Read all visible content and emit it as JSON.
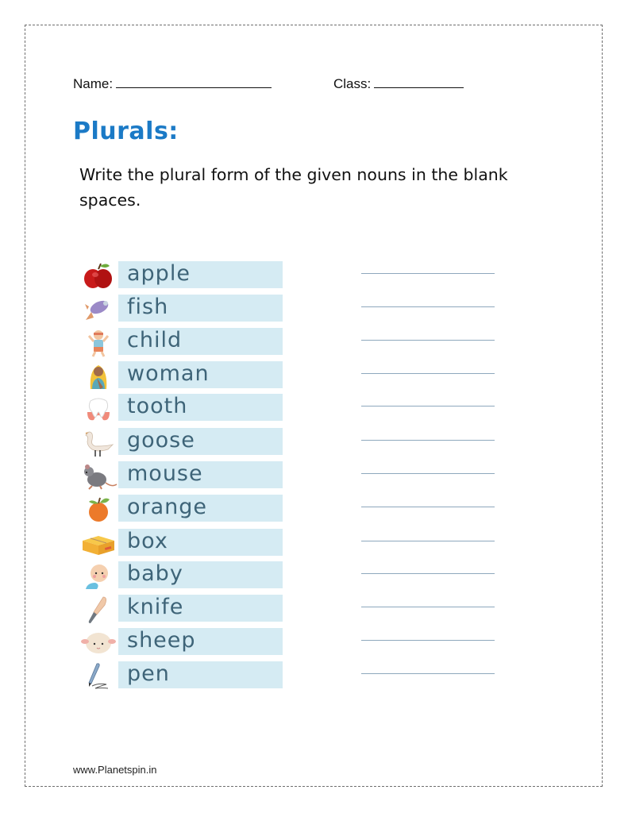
{
  "header": {
    "name_label": "Name:",
    "class_label": "Class:"
  },
  "title": "Plurals:",
  "instructions": "Write the plural form of the given nouns in the blank spaces.",
  "words": [
    {
      "word": "apple",
      "icon": "apple-icon",
      "answer": ""
    },
    {
      "word": "fish",
      "icon": "fish-icon",
      "answer": ""
    },
    {
      "word": "child",
      "icon": "child-icon",
      "answer": ""
    },
    {
      "word": "woman",
      "icon": "woman-icon",
      "answer": ""
    },
    {
      "word": "tooth",
      "icon": "tooth-icon",
      "answer": ""
    },
    {
      "word": "goose",
      "icon": "goose-icon",
      "answer": ""
    },
    {
      "word": "mouse",
      "icon": "mouse-icon",
      "answer": ""
    },
    {
      "word": "orange",
      "icon": "orange-icon",
      "answer": ""
    },
    {
      "word": "box",
      "icon": "box-icon",
      "answer": ""
    },
    {
      "word": "baby",
      "icon": "baby-icon",
      "answer": ""
    },
    {
      "word": "knife",
      "icon": "knife-icon",
      "answer": ""
    },
    {
      "word": "sheep",
      "icon": "sheep-icon",
      "answer": ""
    },
    {
      "word": "pen",
      "icon": "pen-icon",
      "answer": ""
    }
  ],
  "colors": {
    "title": "#1b7ac6",
    "label_bg": "#d5ebf3",
    "label_text": "#3e6478",
    "answer_line": "#8ea8bd"
  },
  "footer": "www.Planetspin.in"
}
